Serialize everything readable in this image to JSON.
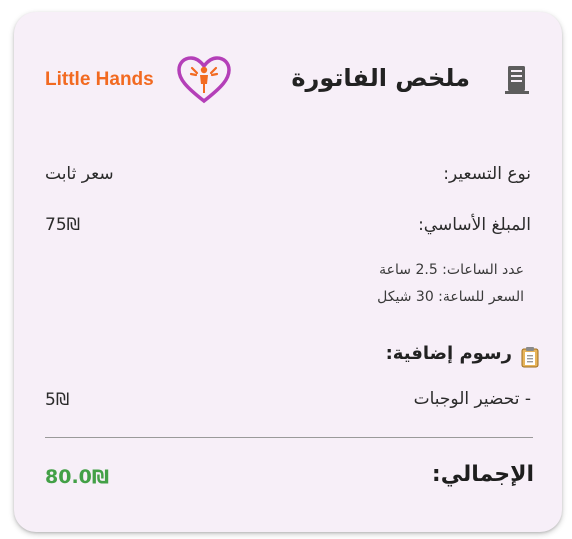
{
  "invoice": {
    "title": "ملخص الفاتورة",
    "brand": "Little Hands",
    "pricing_type_label": "نوع التسعير:",
    "pricing_type_value": "سعر ثابت",
    "base_amount_label": "المبلغ الأساسي:",
    "base_amount_value": "75₪",
    "hours_line": "عدد الساعات: 2.5 ساعة",
    "rate_line": "السعر للساعة: 30 شيكل",
    "extra_fees_label": "رسوم إضافية:",
    "fees": [
      {
        "label": "- تحضير الوجبات",
        "value": "5₪"
      }
    ],
    "total_label": "الإجمالي:",
    "total_value": "80.0₪"
  },
  "colors": {
    "card_bg": "#f7eff8",
    "brand_orange": "#f26a21",
    "brand_heart": "#b43fb8",
    "total_green": "#43a047"
  },
  "icons": {
    "title_icon": "receipt-icon",
    "section_icon": "clipboard-icon",
    "brand_icon": "heart-logo-icon"
  }
}
